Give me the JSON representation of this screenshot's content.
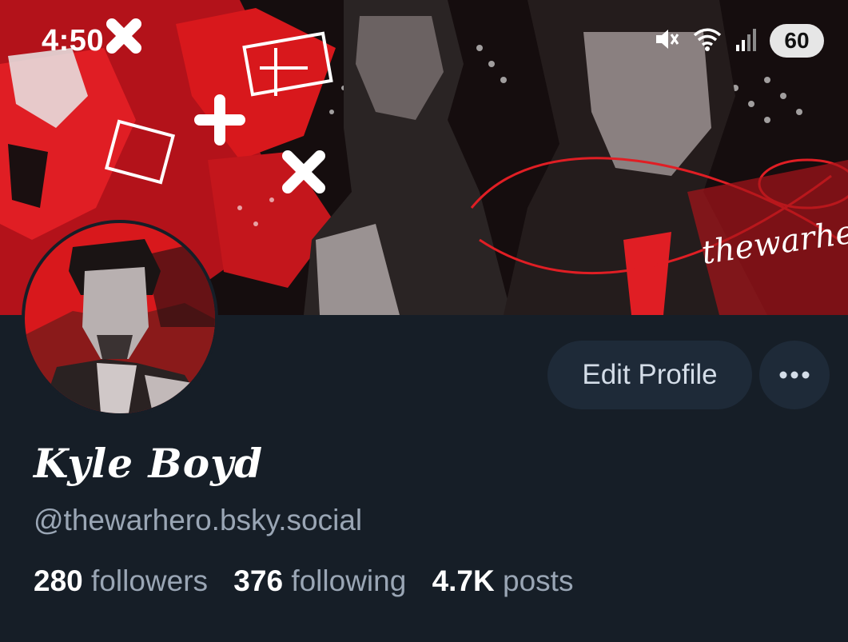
{
  "status_bar": {
    "time": "4:50",
    "battery": "60",
    "icons": [
      "mute-icon",
      "wifi-icon",
      "signal-icon",
      "battery-icon"
    ]
  },
  "banner": {
    "watermark": "thewarhero",
    "colors": {
      "red": "#d8181c",
      "dark": "#140c0d"
    }
  },
  "profile": {
    "display_name": "Kyle Boyd",
    "handle": "@thewarhero.bsky.social",
    "edit_label": "Edit Profile",
    "more_label": "•••",
    "stats": {
      "followers_count": "280",
      "followers_label": "followers",
      "following_count": "376",
      "following_label": "following",
      "posts_count": "4.7K",
      "posts_label": "posts"
    }
  },
  "theme": {
    "background": "#161e27",
    "button_bg": "#1e2a38",
    "muted_text": "#9aa6b5"
  }
}
